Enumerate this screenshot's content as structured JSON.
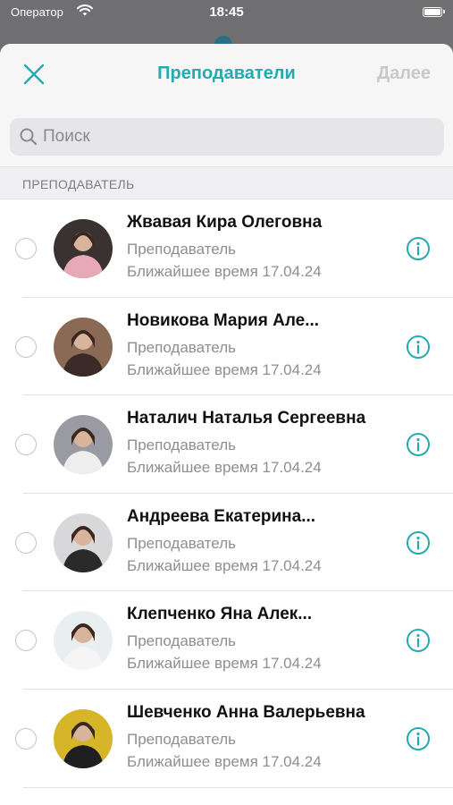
{
  "status_bar": {
    "carrier": "Оператор",
    "time": "18:45"
  },
  "navbar": {
    "title": "Преподаватели",
    "next_label": "Далее",
    "accent_color": "#25aab2",
    "disabled_color": "#c9c9cc"
  },
  "search": {
    "placeholder": "Поиск"
  },
  "section": {
    "label": "ПРЕПОДАВАТЕЛЬ"
  },
  "teachers": [
    {
      "name": "Жвавая Кира Олеговна",
      "role": "Преподаватель",
      "nearest": "Ближайшее время 17.04.24",
      "avatar_bg": "#3a3230",
      "avatar_fg": "#e7a8b8"
    },
    {
      "name": "Новикова Мария Але...",
      "role": "Преподаватель",
      "nearest": "Ближайшее время 17.04.24",
      "avatar_bg": "#8a6a55",
      "avatar_fg": "#3b2b28"
    },
    {
      "name": "Наталич Наталья Сергеевна",
      "role": "Преподаватель",
      "nearest": "Ближайшее время 17.04.24",
      "avatar_bg": "#9a9aa2",
      "avatar_fg": "#eeeeee"
    },
    {
      "name": "Андреева Екатерина...",
      "role": "Преподаватель",
      "nearest": "Ближайшее время 17.04.24",
      "avatar_bg": "#d8d8da",
      "avatar_fg": "#2a2a2a"
    },
    {
      "name": "Клепченко Яна Алек...",
      "role": "Преподаватель",
      "nearest": "Ближайшее время 17.04.24",
      "avatar_bg": "#e9eef0",
      "avatar_fg": "#f5f5f5"
    },
    {
      "name": "Шевченко Анна Валерьевна",
      "role": "Преподаватель",
      "nearest": "Ближайшее время 17.04.24",
      "avatar_bg": "#d7b528",
      "avatar_fg": "#1f1f22"
    }
  ]
}
